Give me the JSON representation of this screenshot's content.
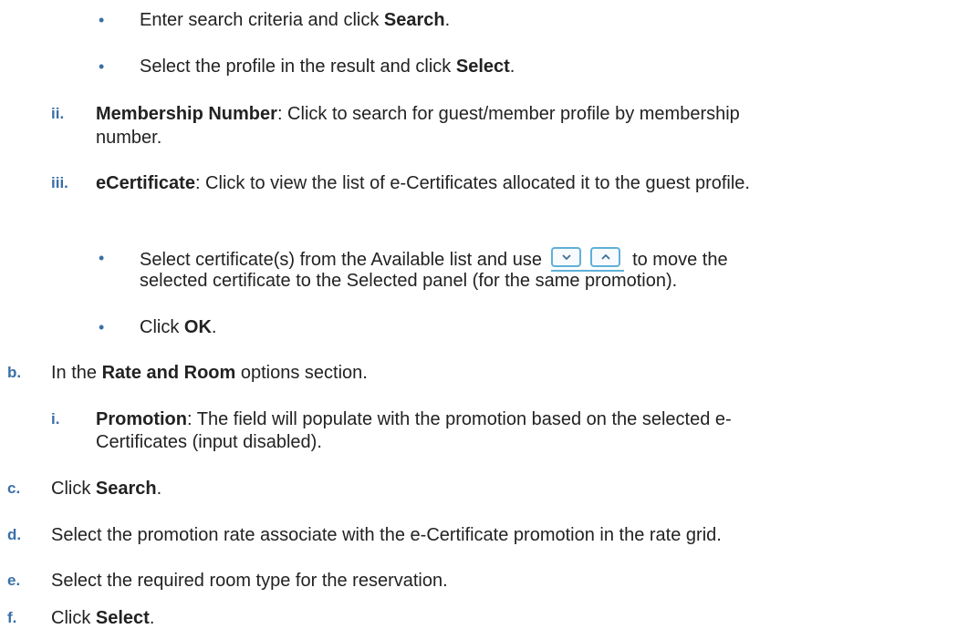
{
  "steps": {
    "search_bullet": {
      "pre": "Enter search criteria and click ",
      "bold": "Search",
      "post": "."
    },
    "select_bullet": {
      "pre": "Select the profile in the result and click ",
      "bold": "Select",
      "post": "."
    },
    "item_ii": {
      "marker": "ii.",
      "bold": "Membership Number",
      "line1": ": Click to search for guest/member profile by membership",
      "line2": "number."
    },
    "item_iii": {
      "marker": "iii.",
      "bold": "eCertificate",
      "text": ": Click to view the list of e-Certificates allocated it to the guest profile."
    },
    "cert_bullet": {
      "pre": "Select certificate(s) from the Available list and use ",
      "post": " to move the",
      "line2": "selected certificate to the Selected panel (for the same promotion)."
    },
    "ok_bullet": {
      "pre": "Click ",
      "bold": "OK",
      "post": "."
    },
    "item_b": {
      "marker": "b.",
      "pre": "In the ",
      "bold": "Rate and Room",
      "post": " options section."
    },
    "item_b_i": {
      "marker": "i.",
      "bold": "Promotion",
      "line1": ": The field will populate with the promotion based on the selected e-",
      "line2": "Certificates (input disabled)."
    },
    "item_c": {
      "marker": "c.",
      "pre": "Click ",
      "bold": "Search",
      "post": "."
    },
    "item_d": {
      "marker": "d.",
      "text": "Select the promotion rate associate with the e-Certificate promotion in the rate grid."
    },
    "item_e": {
      "marker": "e.",
      "text": "Select the required room type for the reservation."
    },
    "item_f": {
      "marker": "f.",
      "pre": "Click ",
      "bold": "Select",
      "post": "."
    }
  },
  "icons": {
    "move_down": "chevron-down-icon",
    "move_up": "chevron-up-icon",
    "accent_color": "#5fb0d8"
  },
  "colors": {
    "marker": "#3a6fa8",
    "text": "#222222"
  }
}
